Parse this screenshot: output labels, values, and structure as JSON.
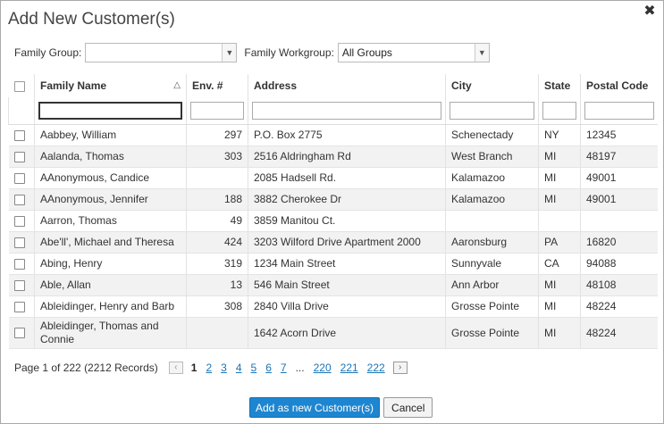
{
  "dialog": {
    "title": "Add New Customer(s)",
    "close_icon": "close-icon"
  },
  "filters": {
    "family_group_label": "Family Group:",
    "family_group_value": "",
    "family_workgroup_label": "Family Workgroup:",
    "family_workgroup_value": "All Groups"
  },
  "table": {
    "columns": {
      "family_name": "Family Name",
      "env": "Env. #",
      "address": "Address",
      "city": "City",
      "state": "State",
      "postal": "Postal Code"
    },
    "sort_icon": "sort-ascending-icon",
    "rows": [
      {
        "name": "Aabbey, William",
        "env": "297",
        "address": "P.O. Box 2775",
        "city": "Schenectady",
        "state": "NY",
        "postal": "12345"
      },
      {
        "name": "Aalanda, Thomas",
        "env": "303",
        "address": "2516 Aldringham Rd",
        "city": "West Branch",
        "state": "MI",
        "postal": "48197"
      },
      {
        "name": "AAnonymous, Candice",
        "env": "",
        "address": "2085 Hadsell Rd.",
        "city": "Kalamazoo",
        "state": "MI",
        "postal": "49001"
      },
      {
        "name": "AAnonymous, Jennifer",
        "env": "188",
        "address": "3882 Cherokee Dr",
        "city": "Kalamazoo",
        "state": "MI",
        "postal": "49001"
      },
      {
        "name": "Aarron, Thomas",
        "env": "49",
        "address": "3859 Manitou Ct.",
        "city": "",
        "state": "",
        "postal": ""
      },
      {
        "name": "Abe'll', Michael and Theresa",
        "env": "424",
        "address": "3203 Wilford Drive Apartment 2000",
        "city": "Aaronsburg",
        "state": "PA",
        "postal": "16820"
      },
      {
        "name": "Abing, Henry",
        "env": "319",
        "address": "1234 Main Street",
        "city": "Sunnyvale",
        "state": "CA",
        "postal": "94088"
      },
      {
        "name": "Able, Allan",
        "env": "13",
        "address": "546 Main Street",
        "city": "Ann Arbor",
        "state": "MI",
        "postal": "48108"
      },
      {
        "name": "Ableidinger, Henry and Barb",
        "env": "308",
        "address": "2840 Villa Drive",
        "city": "Grosse Pointe",
        "state": "MI",
        "postal": "48224"
      },
      {
        "name": "Ableidinger, Thomas and Connie",
        "env": "",
        "address": "1642 Acorn Drive",
        "city": "Grosse Pointe",
        "state": "MI",
        "postal": "48224"
      }
    ]
  },
  "pager": {
    "info": "Page 1 of 222 (2212 Records)",
    "prev": "‹",
    "next": "›",
    "current": "1",
    "pages": [
      "2",
      "3",
      "4",
      "5",
      "6",
      "7"
    ],
    "dots": "...",
    "tail_pages": [
      "220",
      "221",
      "222"
    ]
  },
  "actions": {
    "add": "Add as new Customer(s)",
    "cancel": "Cancel"
  }
}
